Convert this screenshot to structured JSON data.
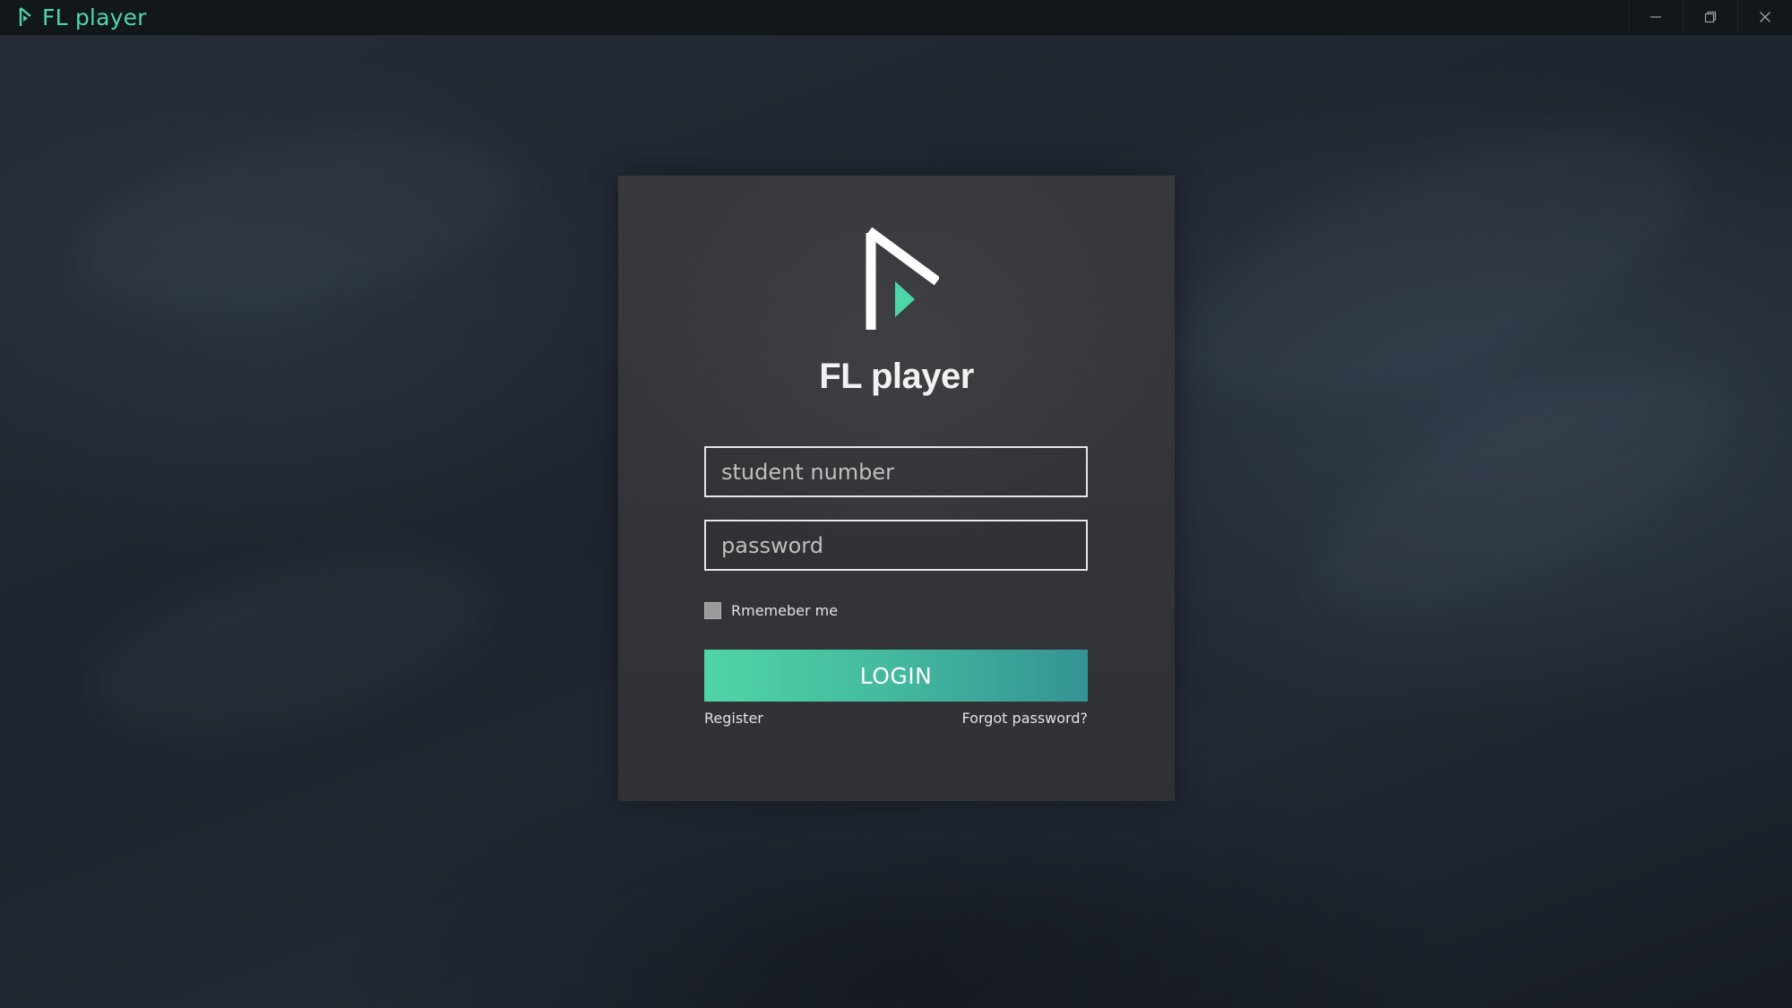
{
  "window": {
    "title": "FL player",
    "controls": [
      "minimize-icon",
      "restore-icon",
      "close-icon"
    ]
  },
  "login": {
    "app_name": "FL player",
    "student_number_placeholder": "student number",
    "password_placeholder": "password",
    "remember_label": "Rmemeber me",
    "remember_checked": false,
    "login_label": "LOGIN",
    "register_label": "Register",
    "forgot_label": "Forgot password?"
  },
  "colors": {
    "accent": "#4fd6a8",
    "button_start": "#50d4a6",
    "button_end": "#349393",
    "card": "#35363a",
    "background": "#1f2630"
  }
}
